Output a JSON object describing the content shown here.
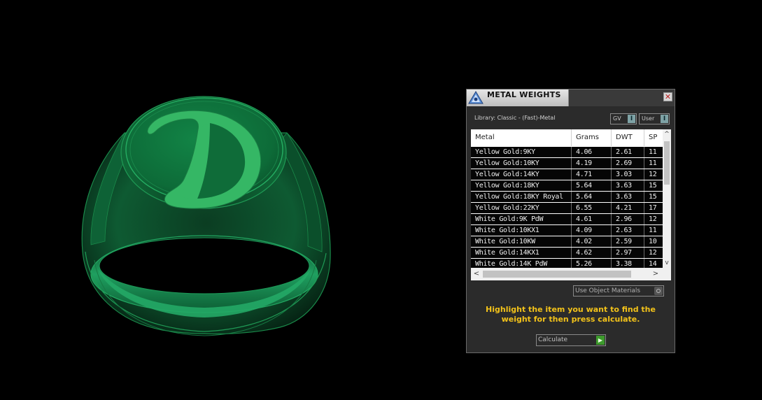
{
  "panel": {
    "title": "METAL WEIGHTS",
    "close_glyph": "✕",
    "library_label": "Library: Classic - (Fast)-Metal",
    "gv_label": "GV",
    "user_label": "User",
    "toggle_glyph": "I"
  },
  "table": {
    "columns": [
      "Metal",
      "Grams",
      "DWT",
      "SP"
    ],
    "rows": [
      [
        "Yellow Gold:9KY",
        "4.06",
        "2.61",
        "11"
      ],
      [
        "Yellow Gold:10KY",
        "4.19",
        "2.69",
        "11"
      ],
      [
        "Yellow Gold:14KY",
        "4.71",
        "3.03",
        "12"
      ],
      [
        "Yellow Gold:18KY",
        "5.64",
        "3.63",
        "15"
      ],
      [
        "Yellow Gold:18KY Royal",
        "5.64",
        "3.63",
        "15"
      ],
      [
        "Yellow Gold:22KY",
        "6.55",
        "4.21",
        "17"
      ],
      [
        "White Gold:9K PdW",
        "4.61",
        "2.96",
        "12"
      ],
      [
        "White Gold:10KX1",
        "4.09",
        "2.63",
        "11"
      ],
      [
        "White Gold:10KW",
        "4.02",
        "2.59",
        "10"
      ],
      [
        "White Gold:14KX1",
        "4.62",
        "2.97",
        "12"
      ],
      [
        "White Gold:14K PdW",
        "5.26",
        "3.38",
        "14"
      ]
    ],
    "scroll_up": "^",
    "scroll_down": "v",
    "scroll_left": "<",
    "scroll_right": ">"
  },
  "use_object_materials": "Use Object Materials",
  "instruction": "Highlight the item you want to find the weight for then press calculate.",
  "calculate_label": "Calculate",
  "calculate_glyph": "▶",
  "colors": {
    "ring_green": "#1f9a55",
    "letter_green": "#33b560",
    "instruction_yellow": "#f2c21a",
    "panel_bg": "#2b2b2b"
  },
  "scene": {
    "object": "signet ring",
    "engraving": "D"
  }
}
